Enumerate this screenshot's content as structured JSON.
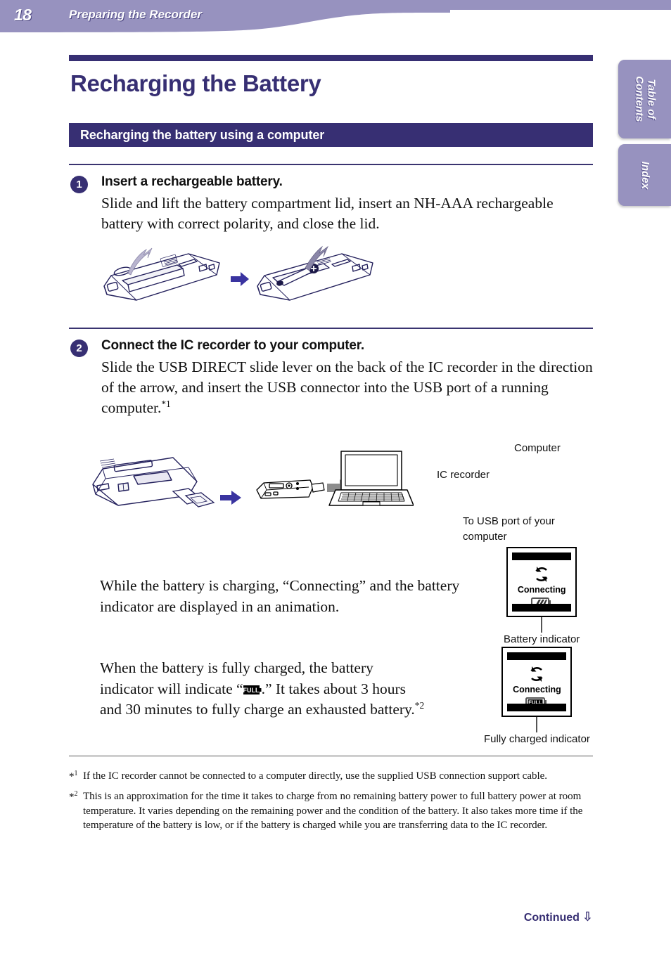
{
  "header": {
    "page_number": "18",
    "title": "Preparing the Recorder",
    "band_color": "#9792bf"
  },
  "side_tabs": [
    {
      "label": "Table of\nContents",
      "name": "table-of-contents"
    },
    {
      "label": "Index",
      "name": "index"
    }
  ],
  "document": {
    "title": "Recharging the Battery",
    "section_title": "Recharging the battery using a computer",
    "accent_color": "#372f73"
  },
  "steps": [
    {
      "number": "1",
      "heading": "Insert a rechargeable battery.",
      "body": "Slide and lift the battery compartment lid, insert an NH-AAA rechargeable battery with correct polarity, and close the lid."
    },
    {
      "number": "2",
      "heading": "Connect the IC recorder to your computer.",
      "body_before_footnote": "Slide the USB DIRECT slide lever on the back of the IC recorder in the direction of the arrow, and insert the USB connector into the USB port of a running computer.",
      "body_footnote_marker": "*1"
    }
  ],
  "figure_step2": {
    "label_computer": "Computer",
    "label_ic_recorder": "IC recorder",
    "label_usb_port": "To USB port of your computer"
  },
  "paragraphs": {
    "charging": "While the battery is charging, “Connecting” and the battery indicator are displayed in an animation.",
    "full_part1": "When the battery is fully charged, the battery indicator will indicate “",
    "full_part2": ".” It takes about 3 hours and 30 minutes to fully charge an exhausted battery.",
    "full_footnote_marker": "*2"
  },
  "lcd_panels": [
    {
      "name": "charging-indicator",
      "screen_text": "Connecting",
      "battery_state": "charging",
      "caption": "Battery indicator"
    },
    {
      "name": "fully-charged-indicator",
      "screen_text": "Connecting",
      "battery_state": "FULL",
      "caption": "Fully charged indicator"
    }
  ],
  "footnotes": [
    {
      "marker_star": "*",
      "marker_index": "1",
      "text": "If the IC recorder cannot be connected to a computer directly, use the supplied USB connection support cable."
    },
    {
      "marker_star": "*",
      "marker_index": "2",
      "text": "This is an approximation for the time it takes to charge from no remaining battery power to full battery power at room temperature. It varies depending on the remaining power and the condition of the battery. It also takes more time if the temperature of the battery is low, or if the battery is charged while you are transferring data to the IC recorder."
    }
  ],
  "footer": {
    "continued_label": "Continued",
    "continued_arrow": "⇩"
  }
}
